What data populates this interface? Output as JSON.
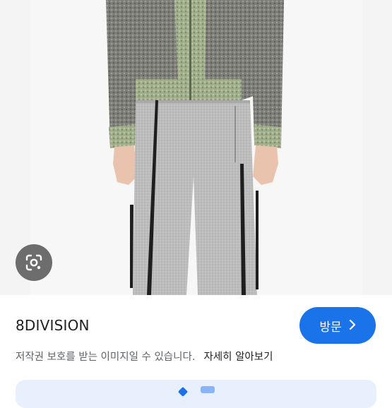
{
  "source": {
    "name": "8DIVISION"
  },
  "visit_button": {
    "label": "방문",
    "icon": "chevron-right-icon"
  },
  "notice": {
    "text": "저작권 보호를 받는 이미지일 수 있습니다.",
    "more_link": "자세히 알아보기"
  },
  "lens_button": {
    "icon": "google-lens-icon"
  },
  "colors": {
    "accent": "#1a73e8",
    "text": "#202124",
    "muted": "#5f6368"
  }
}
